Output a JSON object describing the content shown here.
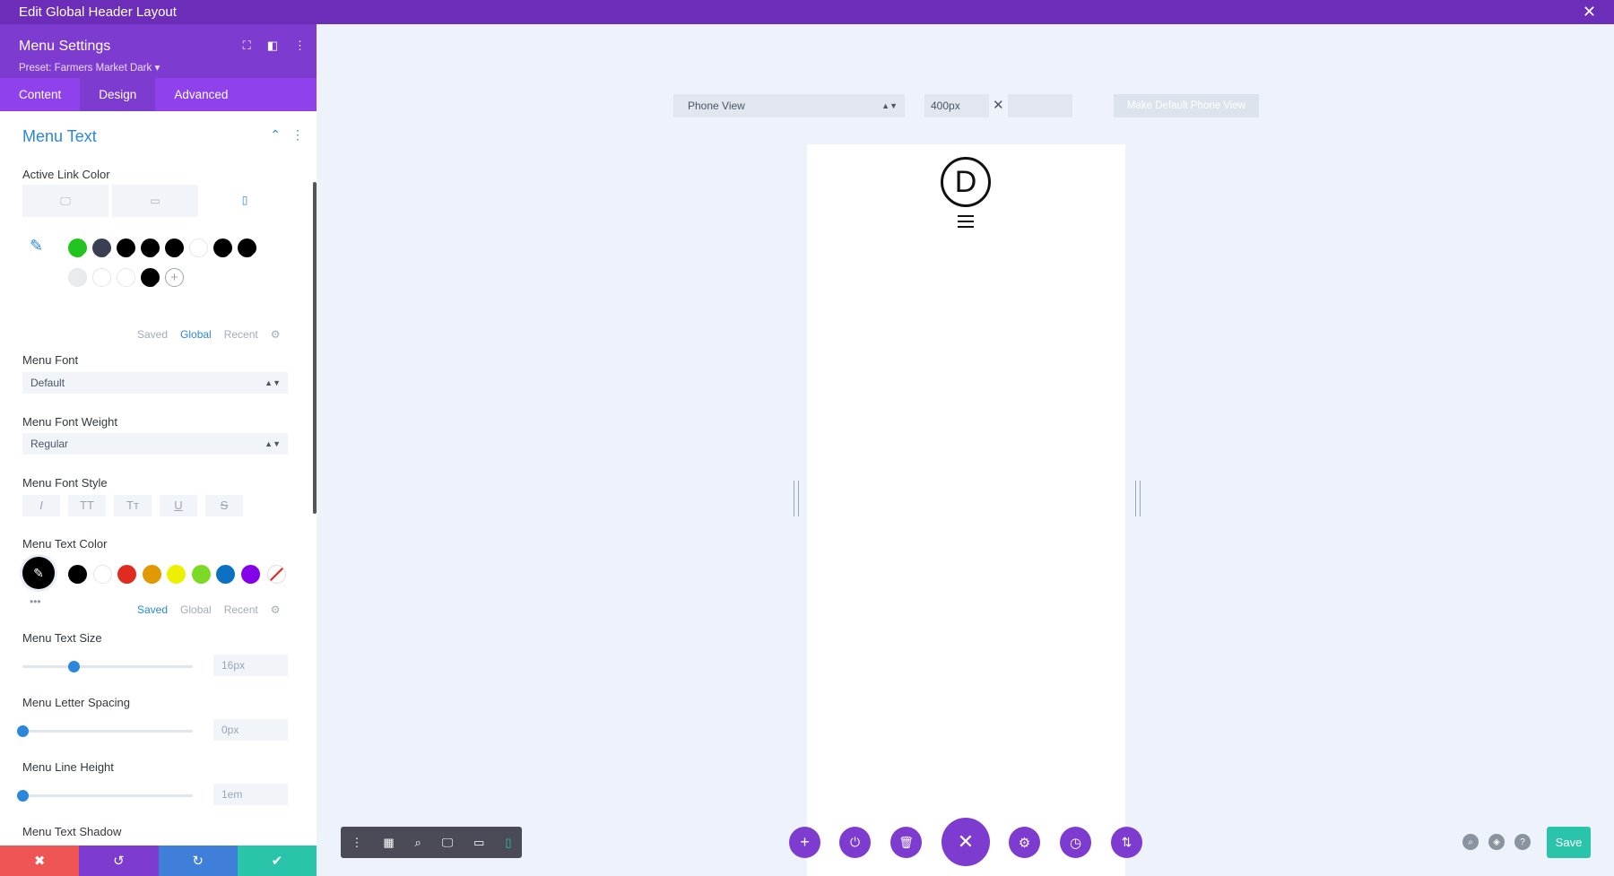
{
  "window": {
    "title": "Edit Global Header Layout",
    "close_icon": "✕"
  },
  "panel": {
    "title": "Menu Settings",
    "preset": "Preset: Farmers Market Dark ▾",
    "header_icons": [
      "⛶",
      "◧",
      "⋮"
    ],
    "tabs": [
      "Content",
      "Design",
      "Advanced"
    ],
    "active_tab": "Design",
    "section_title": "Menu Text",
    "active_link_color": {
      "label": "Active Link Color",
      "devices": [
        "🖵",
        "▭",
        "▯"
      ],
      "swatches": [
        "#22c41f",
        "#3a4052",
        "#000000",
        "#000000",
        "#000000",
        "#ffffff",
        "#000000",
        "#000000",
        "#e9ecef",
        "#ffffff",
        "#ffffff",
        "#000000"
      ],
      "sub_tabs": [
        "Saved",
        "Global",
        "Recent"
      ],
      "active_sub_tab": "Global",
      "add_icon": "+"
    },
    "menu_font": {
      "label": "Menu Font",
      "value": "Default"
    },
    "menu_font_weight": {
      "label": "Menu Font Weight",
      "value": "Regular"
    },
    "menu_font_style": {
      "label": "Menu Font Style",
      "buttons": [
        "I",
        "TT",
        "Tт",
        "U",
        "S"
      ]
    },
    "menu_text_color": {
      "label": "Menu Text Color",
      "swatches": [
        "#000000",
        "#ffffff",
        "#e02b20",
        "#e09900",
        "#edf000",
        "#7cda24",
        "#0c71c3",
        "#8300e9"
      ],
      "sub_tabs": [
        "Saved",
        "Global",
        "Recent"
      ],
      "active_sub_tab": "Saved",
      "more_label": "•••"
    },
    "menu_text_size": {
      "label": "Menu Text Size",
      "value": "16px",
      "level": 0.3
    },
    "menu_letter_spacing": {
      "label": "Menu Letter Spacing",
      "value": "0px",
      "level": 0.0
    },
    "menu_line_height": {
      "label": "Menu Line Height",
      "value": "1em",
      "level": 0.0
    },
    "menu_text_shadow": {
      "label": "Menu Text Shadow"
    },
    "bottom_actions": [
      {
        "icon": "✖",
        "color": "#ef5555"
      },
      {
        "icon": "↺",
        "color": "#7e3bd0"
      },
      {
        "icon": "↻",
        "color": "#3f7fd9"
      },
      {
        "icon": "✔",
        "color": "#29c4a9"
      }
    ]
  },
  "canvas": {
    "view_select": "Phone View",
    "width_value": "400px",
    "times": "✕",
    "make_default": "Make Default Phone View",
    "logo_letter": "D"
  },
  "dark_toolbar": [
    "⋮",
    "▦",
    "⌕",
    "🖵",
    "▭",
    "▯"
  ],
  "bottom_buttons": [
    "+",
    "⏻",
    "🗑",
    "✕",
    "⚙",
    "◷",
    "⇅"
  ],
  "right_icons": [
    "⌕",
    "◈",
    "?"
  ],
  "save_label": "Save"
}
